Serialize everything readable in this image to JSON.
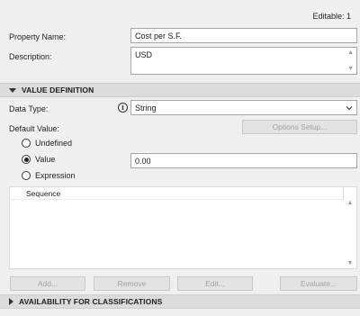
{
  "header": {
    "editable_label": "Editable: 1"
  },
  "property_name": {
    "label": "Property Name:",
    "value": "Cost per S.F."
  },
  "description": {
    "label": "Description:",
    "value": "USD"
  },
  "value_definition": {
    "title": "VALUE DEFINITION",
    "data_type_label": "Data Type:",
    "data_type_value": "String",
    "default_value_label": "Default Value:",
    "options_setup_label": "Options Setup...",
    "options": [
      {
        "label": "Undefined",
        "selected": false
      },
      {
        "label": "Value",
        "selected": true
      },
      {
        "label": "Expression",
        "selected": false
      }
    ],
    "value_field": "0.00",
    "list_header": "Sequence",
    "buttons": {
      "add": "Add...",
      "remove": "Remove",
      "edit": "Edit...",
      "evaluate": "Evaluate..."
    }
  },
  "availability": {
    "title": "AVAILABILITY FOR CLASSIFICATIONS"
  },
  "icons": {
    "info": "info-icon",
    "dropdown": "chevron-down-icon",
    "scroll_up": "scroll-up-arrow-icon",
    "scroll_down": "scroll-down-arrow-icon"
  }
}
